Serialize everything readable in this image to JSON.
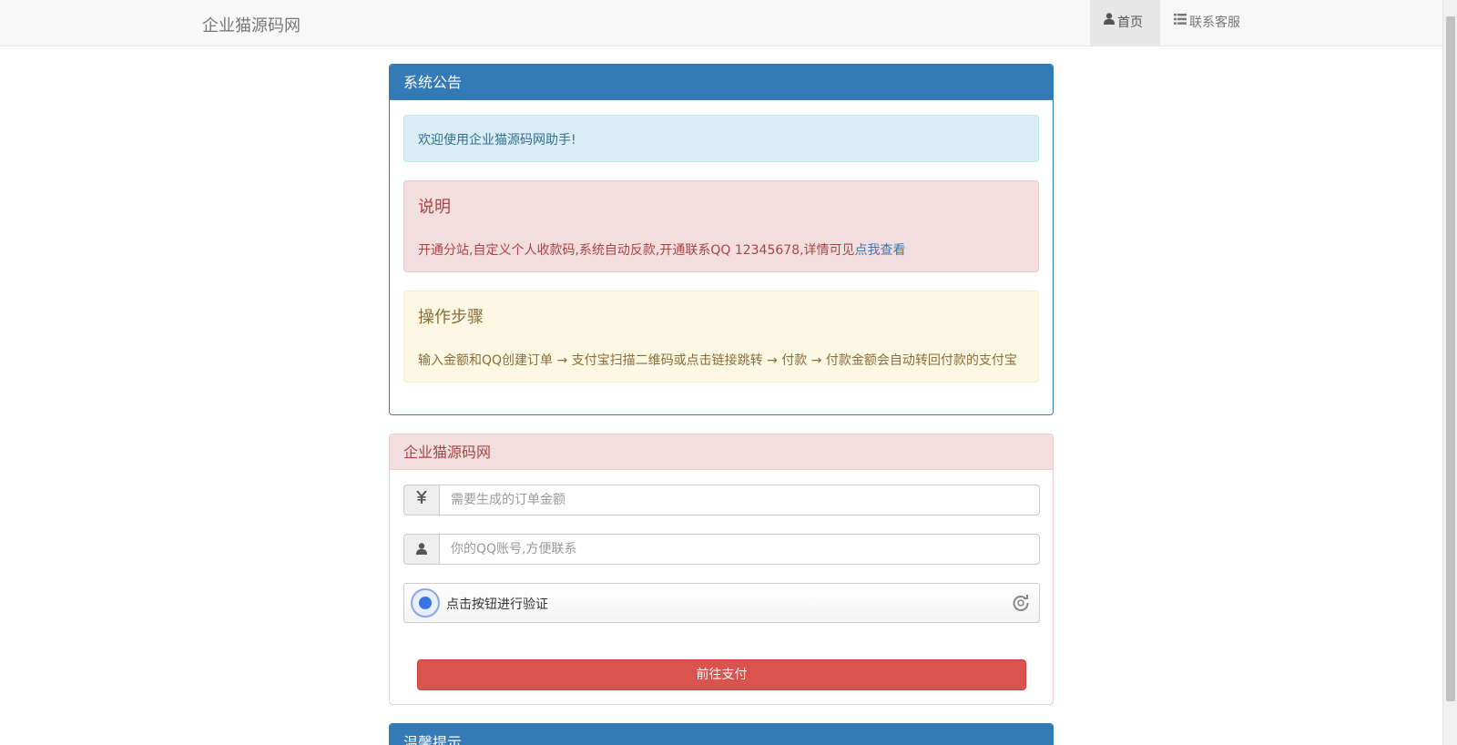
{
  "navbar": {
    "brand": "企业猫源码网",
    "items": [
      {
        "label": "首页",
        "icon": "user-icon",
        "active": true
      },
      {
        "label": "联系客服",
        "icon": "list-icon",
        "active": false
      }
    ]
  },
  "notice_panel": {
    "title": "系统公告",
    "welcome": "欢迎使用企业猫源码网助手!",
    "description": {
      "heading": "说明",
      "text": "开通分站,自定义个人收款码,系统自动反款,开通联系QQ 12345678,详情可见",
      "link": "点我查看"
    },
    "steps": {
      "heading": "操作步骤",
      "text": "输入金额和QQ创建订单 → 支付宝扫描二维码或点击链接跳转 → 付款 → 付款金额会自动转回付款的支付宝"
    }
  },
  "order_panel": {
    "title": "企业猫源码网",
    "amount": {
      "icon": "yen-icon",
      "symbol": "¥",
      "placeholder": "需要生成的订单金额",
      "value": ""
    },
    "qq": {
      "icon": "user-icon",
      "placeholder": "你的QQ账号,方便联系",
      "value": ""
    },
    "captcha": {
      "label": "点击按钮进行验证",
      "icon": "refresh-icon"
    },
    "pay_button": "前往支付"
  },
  "tips_panel": {
    "title": "温馨提示"
  },
  "colors": {
    "primary": "#337ab7",
    "danger": "#d9534f",
    "info_bg": "#d9edf7",
    "danger_bg": "#f2dede",
    "warning_bg": "#fcf8e3"
  }
}
